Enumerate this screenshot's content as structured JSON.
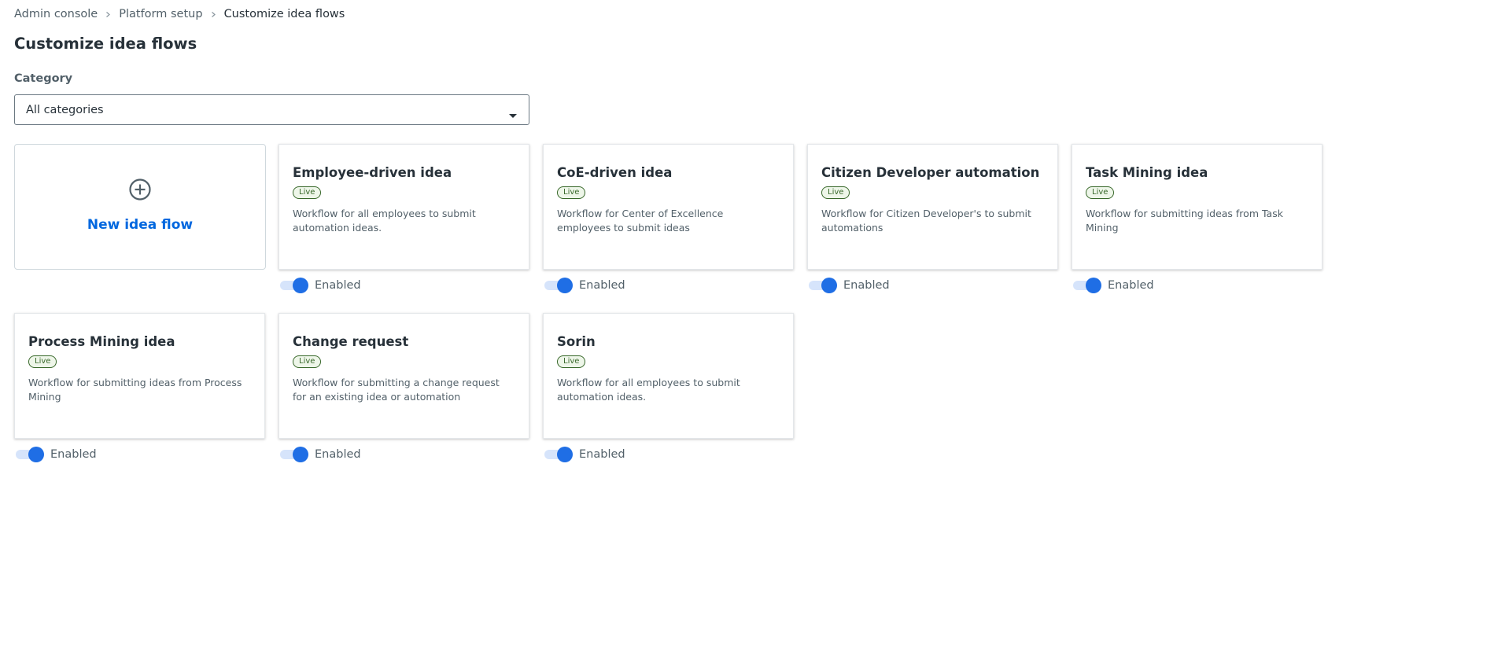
{
  "breadcrumb": [
    "Admin console",
    "Platform setup",
    "Customize idea flows"
  ],
  "page_title": "Customize idea flows",
  "category": {
    "label": "Category",
    "value": "All categories"
  },
  "new_flow": {
    "label": "New idea flow",
    "icon": "plus-circle-icon"
  },
  "cards": [
    {
      "title": "Employee-driven idea",
      "badge": "Live",
      "description": "Workflow for all employees to submit automation ideas.",
      "toggle_label": "Enabled",
      "enabled": true
    },
    {
      "title": "CoE-driven idea",
      "badge": "Live",
      "description": "Workflow for Center of Excellence employees to submit ideas",
      "toggle_label": "Enabled",
      "enabled": true
    },
    {
      "title": "Citizen Developer automation",
      "badge": "Live",
      "description": "Workflow for Citizen Developer's to submit automations",
      "toggle_label": "Enabled",
      "enabled": true
    },
    {
      "title": "Task Mining idea",
      "badge": "Live",
      "description": "Workflow for submitting ideas from Task Mining",
      "toggle_label": "Enabled",
      "enabled": true
    },
    {
      "title": "Process Mining idea",
      "badge": "Live",
      "description": "Workflow for submitting ideas from Process Mining",
      "toggle_label": "Enabled",
      "enabled": true
    },
    {
      "title": "Change request",
      "badge": "Live",
      "description": "Workflow for submitting a change request for an existing idea or automation",
      "toggle_label": "Enabled",
      "enabled": true
    },
    {
      "title": "Sorin",
      "badge": "Live",
      "description": "Workflow for all employees to submit automation ideas.",
      "toggle_label": "Enabled",
      "enabled": true
    }
  ],
  "colors": {
    "accent": "#1f6ee5",
    "link": "#0067df",
    "live_badge": "#38682a",
    "text_primary": "#273139",
    "text_secondary": "#526069"
  }
}
